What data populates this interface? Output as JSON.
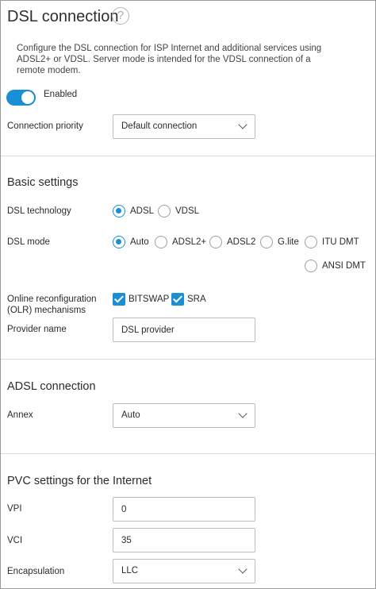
{
  "page": {
    "title": "DSL connection",
    "help_icon": "?",
    "description": "Configure the DSL connection for ISP Internet and additional services using ADSL2+ or VDSL. Server mode is intended for the VDSL connection of a remote modem."
  },
  "enabled_toggle": {
    "label": "Enabled",
    "state": true
  },
  "connection_priority": {
    "label": "Connection priority",
    "value": "Default connection"
  },
  "basic_settings": {
    "title": "Basic settings",
    "dsl_technology": {
      "label": "DSL technology",
      "options": [
        {
          "label": "ADSL",
          "checked": true
        },
        {
          "label": "VDSL",
          "checked": false
        }
      ]
    },
    "dsl_mode": {
      "label": "DSL mode",
      "options": [
        {
          "label": "Auto",
          "checked": true
        },
        {
          "label": "ADSL2+",
          "checked": false
        },
        {
          "label": "ADSL2",
          "checked": false
        },
        {
          "label": "G.lite",
          "checked": false
        },
        {
          "label": "ITU DMT",
          "checked": false
        },
        {
          "label": "ANSI DMT",
          "checked": false
        }
      ]
    },
    "olr": {
      "label_line1": "Online reconfiguration",
      "label_line2": "(OLR) mechanisms",
      "options": [
        {
          "label": "BITSWAP",
          "checked": true
        },
        {
          "label": "SRA",
          "checked": true
        }
      ]
    },
    "provider_name": {
      "label": "Provider name",
      "value": "DSL provider"
    }
  },
  "adsl_connection": {
    "title": "ADSL connection",
    "annex": {
      "label": "Annex",
      "value": "Auto"
    }
  },
  "pvc_settings": {
    "title": "PVC settings for the Internet",
    "vpi": {
      "label": "VPI",
      "value": "0"
    },
    "vci": {
      "label": "VCI",
      "value": "35"
    },
    "encapsulation": {
      "label": "Encapsulation",
      "value": "LLC"
    }
  },
  "colors": {
    "accent": "#1a8fd6",
    "border": "#bdbdbd",
    "divider": "#dcdcdc"
  }
}
